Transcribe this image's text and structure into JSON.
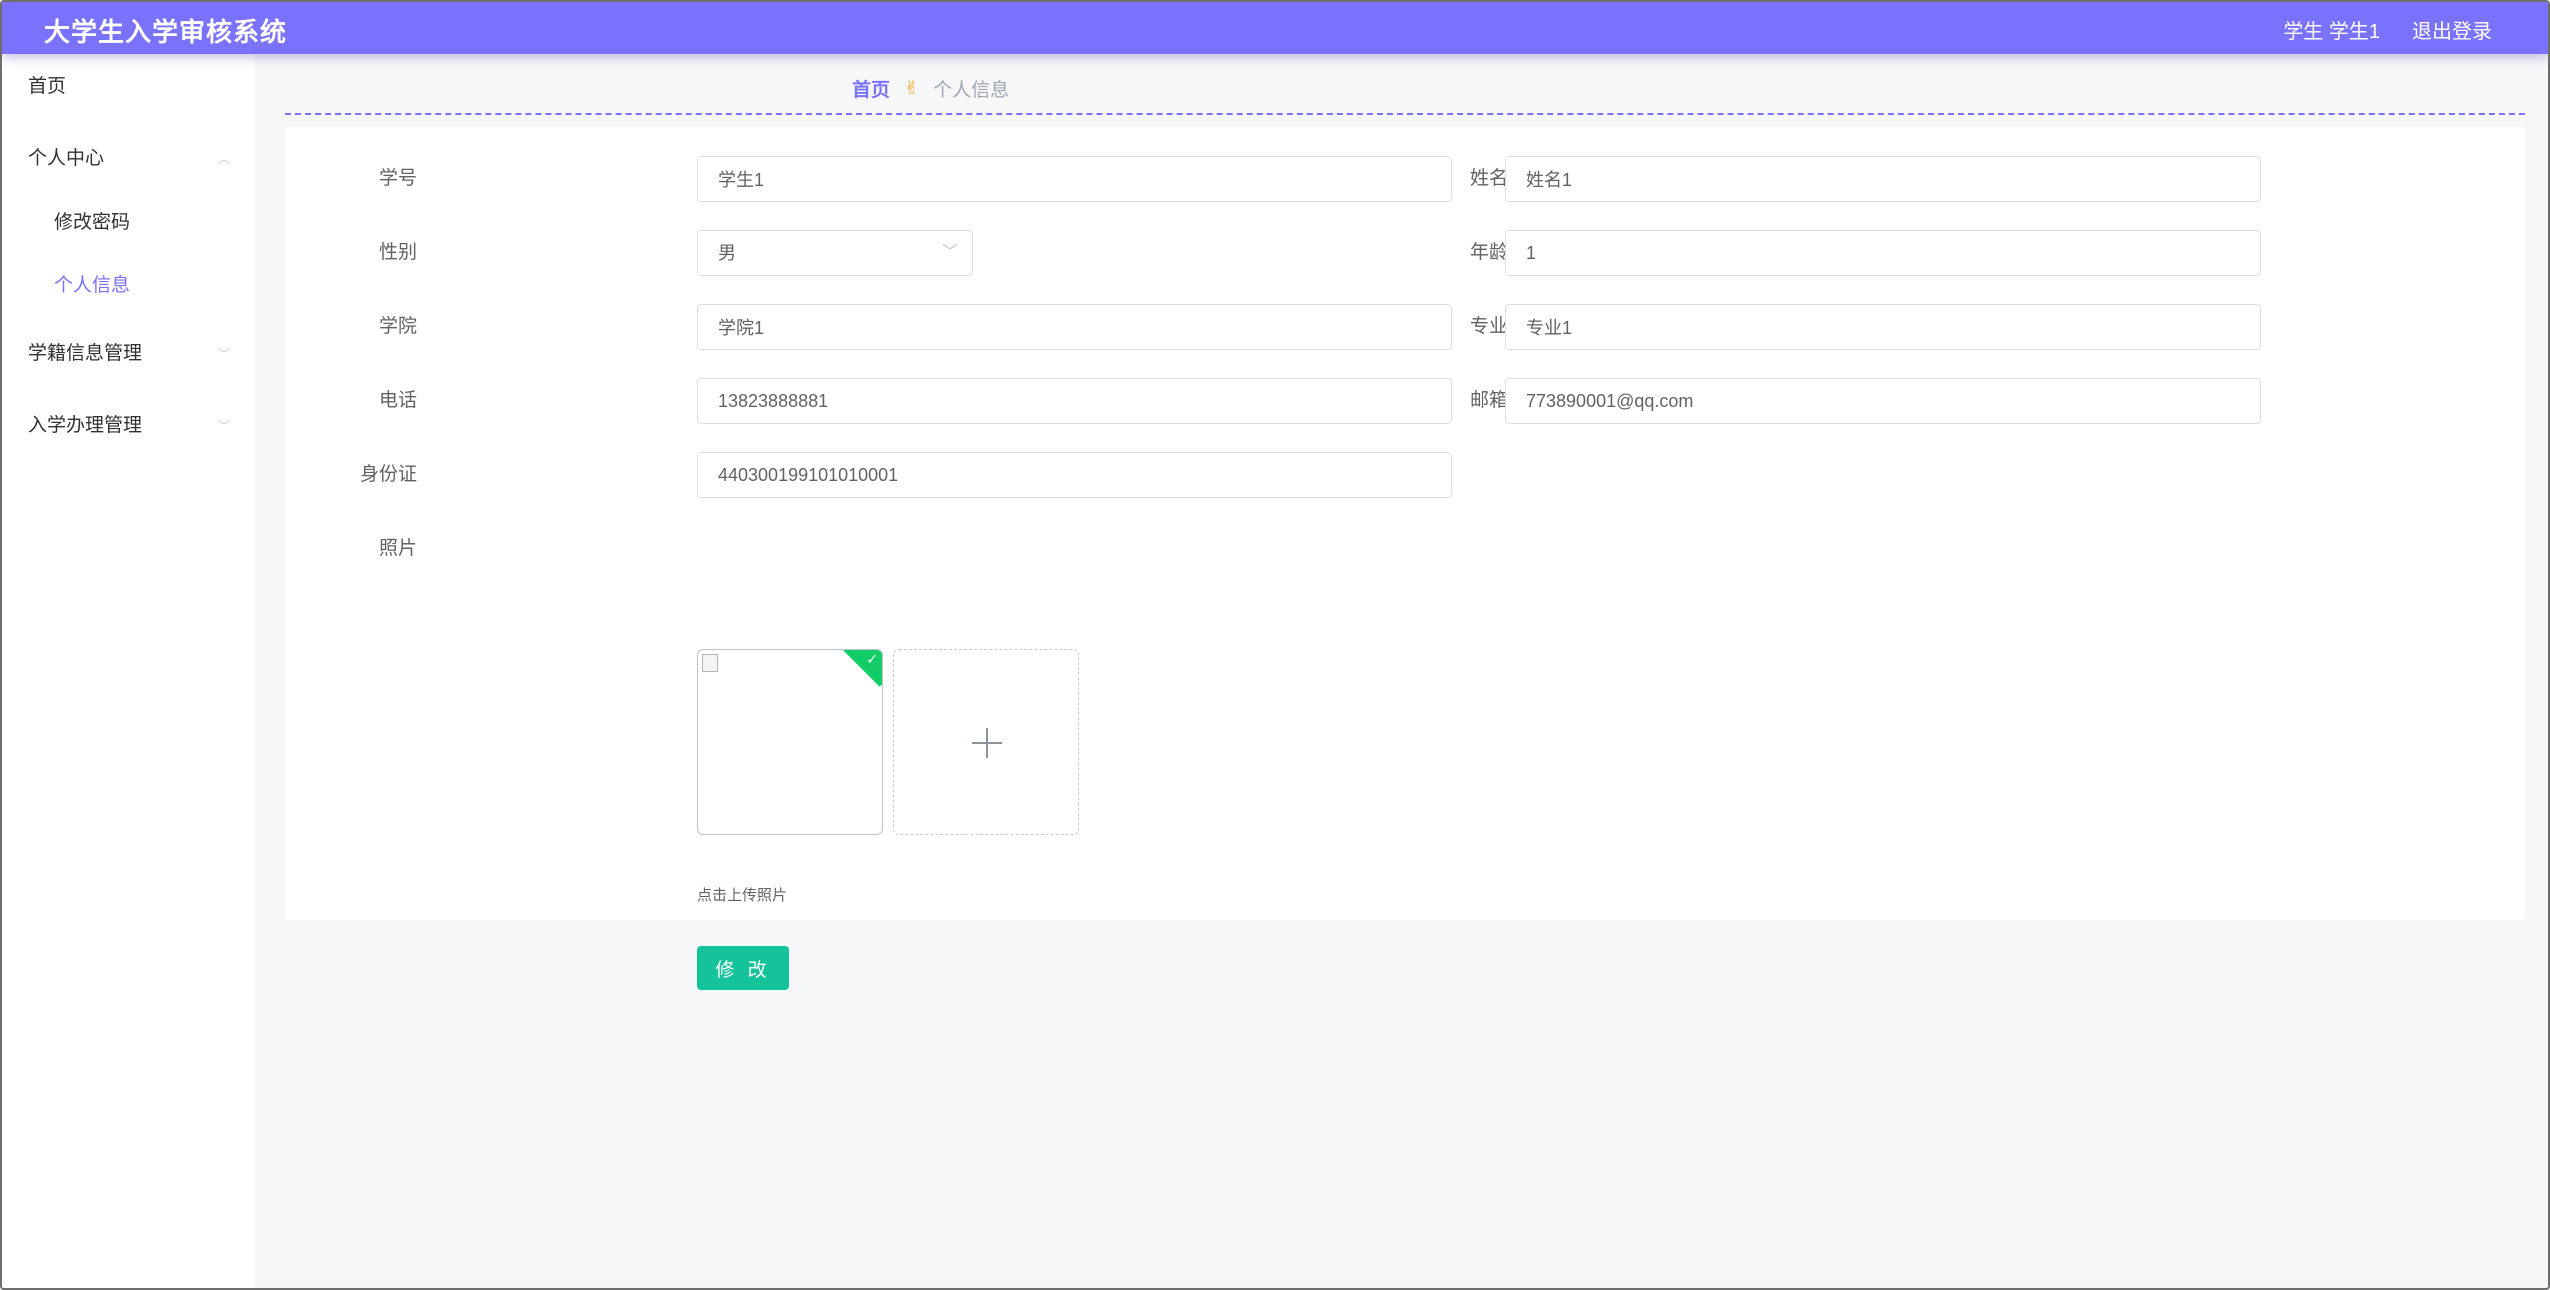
{
  "header": {
    "title": "大学生入学审核系统",
    "user": "学生 学生1",
    "logout": "退出登录",
    "color": "#7a72fb"
  },
  "sidebar": {
    "home": "首页",
    "personal_center": "个人中心",
    "change_password": "修改密码",
    "personal_info": "个人信息",
    "student_record_mgmt": "学籍信息管理",
    "enrollment_mgmt": "入学办理管理"
  },
  "breadcrumb": {
    "home": "首页",
    "separator_icon": "victory-hand-icon",
    "current": "个人信息"
  },
  "form": {
    "student_id": {
      "label": "学号",
      "value": "学生1"
    },
    "name": {
      "label": "姓名",
      "value": "姓名1"
    },
    "gender": {
      "label": "性别",
      "value": "男"
    },
    "age": {
      "label": "年龄",
      "value": "1"
    },
    "college": {
      "label": "学院",
      "value": "学院1"
    },
    "major": {
      "label": "专业",
      "value": "专业1"
    },
    "phone": {
      "label": "电话",
      "value": "13823888881"
    },
    "email": {
      "label": "邮箱",
      "value": "773890001@qq.com"
    },
    "id_card": {
      "label": "身份证",
      "value": "440300199101010001"
    },
    "photo": {
      "label": "照片",
      "upload_tip": "点击上传照片"
    },
    "submit": "修 改"
  },
  "colors": {
    "accent": "#7a72fb",
    "submit": "#15c39a",
    "success": "#13ce66"
  }
}
